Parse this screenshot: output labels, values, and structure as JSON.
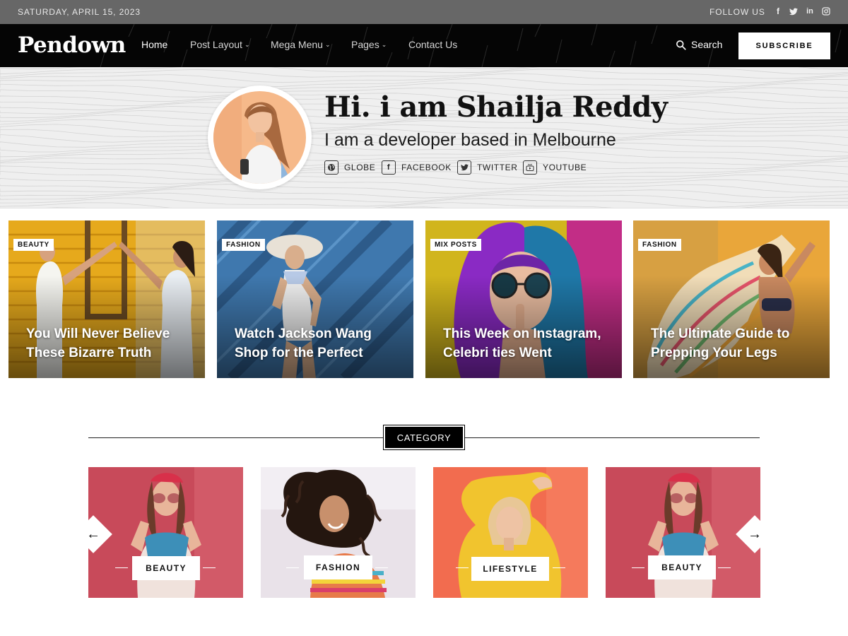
{
  "topbar": {
    "date": "SATURDAY, APRIL 15, 2023",
    "follow_label": "FOLLOW US",
    "social_icons": [
      "facebook-icon",
      "twitter-icon",
      "linkedin-icon",
      "instagram-icon"
    ]
  },
  "nav": {
    "logo": "Pendown",
    "items": [
      {
        "label": "Home",
        "active": true
      },
      {
        "label": "Post Layout",
        "dropdown": true
      },
      {
        "label": "Mega Menu",
        "dropdown": true
      },
      {
        "label": "Pages",
        "dropdown": true
      },
      {
        "label": "Contact Us"
      }
    ],
    "search_label": "Search",
    "subscribe_label": "SUBSCRIBE"
  },
  "hero": {
    "title": "Hi. i am Shailja Reddy",
    "subtitle": "I am a developer based in Melbourne",
    "links": [
      {
        "label": "GLOBE",
        "icon": "globe-icon"
      },
      {
        "label": "FACEBOOK",
        "icon": "facebook-icon"
      },
      {
        "label": "TWITTER",
        "icon": "twitter-icon"
      },
      {
        "label": "YOUTUBE",
        "icon": "youtube-icon"
      }
    ]
  },
  "featured": [
    {
      "category": "BEAUTY",
      "title": "You Will Never Believe These Bizarre Truth"
    },
    {
      "category": "FASHION",
      "title": "Watch Jackson Wang Shop for the Perfect"
    },
    {
      "category": "MIX POSTS",
      "title": "This Week on Instagram, Celebri ties Went"
    },
    {
      "category": "FASHION",
      "title": "The Ultimate Guide to Prepping Your Legs"
    }
  ],
  "category_section": {
    "heading": "CATEGORY",
    "items": [
      {
        "label": "BEAUTY"
      },
      {
        "label": "FASHION"
      },
      {
        "label": "LIFESTYLE"
      },
      {
        "label": "BEAUTY"
      }
    ],
    "prev_icon": "arrow-left-icon",
    "next_icon": "arrow-right-icon"
  },
  "colors": {
    "topbar_bg": "#676767",
    "nav_bg": "#050505",
    "hero_bg": "#efefef",
    "accent": "#000000"
  }
}
